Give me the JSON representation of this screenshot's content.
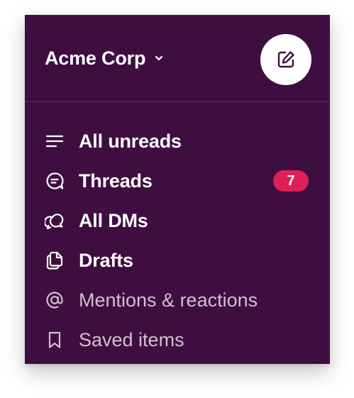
{
  "workspace": {
    "name": "Acme Corp",
    "dropdown_icon": "chevron-down-icon"
  },
  "compose": {
    "icon": "compose-icon"
  },
  "nav": {
    "items": [
      {
        "label": "All unreads",
        "icon": "lines-icon",
        "state": "unread"
      },
      {
        "label": "Threads",
        "icon": "threads-icon",
        "state": "unread",
        "badge": "7"
      },
      {
        "label": "All DMs",
        "icon": "dms-icon",
        "state": "unread"
      },
      {
        "label": "Drafts",
        "icon": "drafts-icon",
        "state": "unread"
      },
      {
        "label": "Mentions & reactions",
        "icon": "at-icon",
        "state": "read"
      },
      {
        "label": "Saved items",
        "icon": "bookmark-icon",
        "state": "read"
      }
    ]
  },
  "colors": {
    "sidebar_bg": "#3f0e40",
    "badge_bg": "#e01e5a",
    "muted_text": "#cfc1cf"
  }
}
